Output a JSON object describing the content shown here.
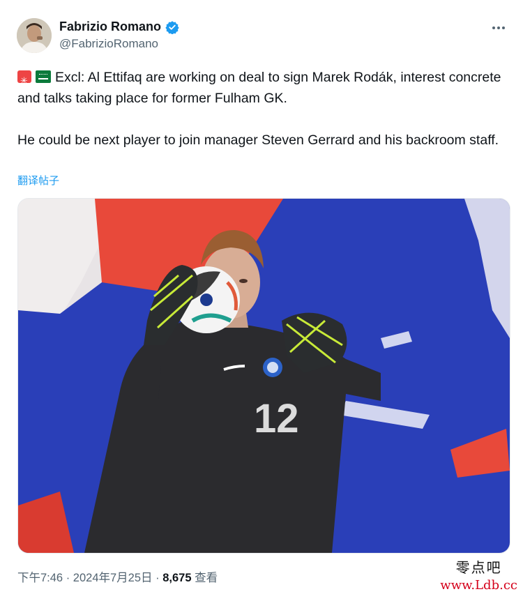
{
  "author": {
    "display_name": "Fabrizio Romano",
    "handle": "@FabrizioRomano",
    "verified": true,
    "verified_color": "#1d9bf0"
  },
  "tweet": {
    "line1_text": "Excl: Al Ettifaq are working on deal to sign Marek Rodák, interest concrete and talks taking place for former Fulham GK.",
    "paragraph2": "He could be next player to join manager Steven Gerrard and his backroom staff.",
    "emoji_icons": [
      "rotating-light-icon",
      "saudi-arabia-flag-icon"
    ],
    "translate_label": "翻译帖子"
  },
  "media": {
    "shirt_number": "12"
  },
  "meta": {
    "time": "下午7:46",
    "separator1": " · ",
    "date": "2024年7月25日",
    "separator2": " · ",
    "views_count": "8,675",
    "views_label": " 查看"
  },
  "watermark": {
    "site_cn": "零点吧",
    "site_url": "www.Ldb.cc"
  },
  "colors": {
    "link": "#1d9bf0",
    "secondary_text": "#536471",
    "watermark_url": "#d4001a"
  }
}
